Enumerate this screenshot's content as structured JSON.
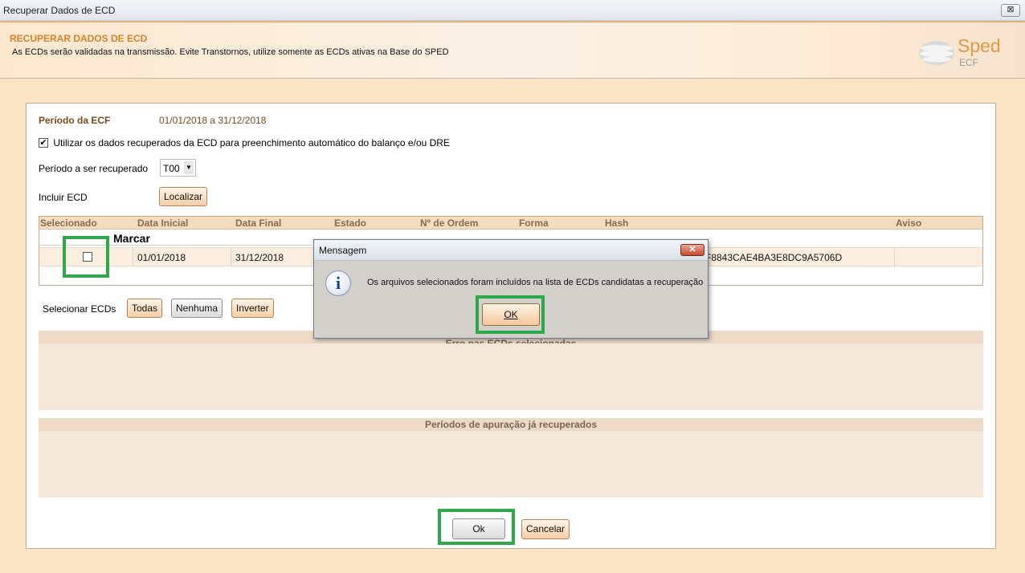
{
  "window": {
    "title": "Recuperar Dados de ECD",
    "close_glyph": "⊠"
  },
  "header": {
    "title": "RECUPERAR DADOS DE ECD",
    "subtitle": "As ECDs serão validadas na transmissão. Evite Transtornos, utilize somente as ECDs ativas na Base do SPED",
    "logo_word": "Sped",
    "logo_sub": "ECF"
  },
  "form": {
    "periodo_ecf_label": "Período da ECF",
    "periodo_ecf_value": "01/01/2018 a 31/12/2018",
    "use_data_checkbox_glyph": "✔",
    "use_data_label": "Utilizar os dados recuperados da ECD para preenchimento automático do balanço e/ou DRE",
    "periodo_recuperado_label": "Período a ser recuperado",
    "periodo_recuperado_value": "T00",
    "incluir_ecd_label": "Incluir ECD",
    "localizar_button": "Localizar"
  },
  "grid": {
    "columns": [
      "Selecionado",
      "Data Inicial",
      "Data Final",
      "Estado",
      "Nº de Ordem",
      "Forma",
      "Hash",
      "Aviso"
    ],
    "tooltip": "Marcar",
    "row": {
      "data_inicial": "01/01/2018",
      "data_final": "31/12/2018",
      "hash_partial": "F8843CAE4BA3E8DC9A5706D"
    }
  },
  "select_ecds": {
    "label": "Selecionar ECDs",
    "todas": "Todas",
    "nenhuma": "Nenhuma",
    "inverter": "Inverter"
  },
  "sections": {
    "erro_header_partial": "Erro nas ECDs selecionadas",
    "periodos_header": "Períodos de apuração já recuperados"
  },
  "footer": {
    "ok_button": "Ok",
    "cancel_button": "Cancelar"
  },
  "dialog": {
    "title": "Mensagem",
    "close_glyph": "✕",
    "icon_letter": "i",
    "message": "Os arquivos selecionados foram incluídos na lista de ECDs candidatas a recuperação",
    "ok_button": "OK"
  },
  "colors": {
    "accent_orange": "#d9822b",
    "highlight_green": "#2ea84a",
    "label_brown": "#7b4a1e"
  }
}
